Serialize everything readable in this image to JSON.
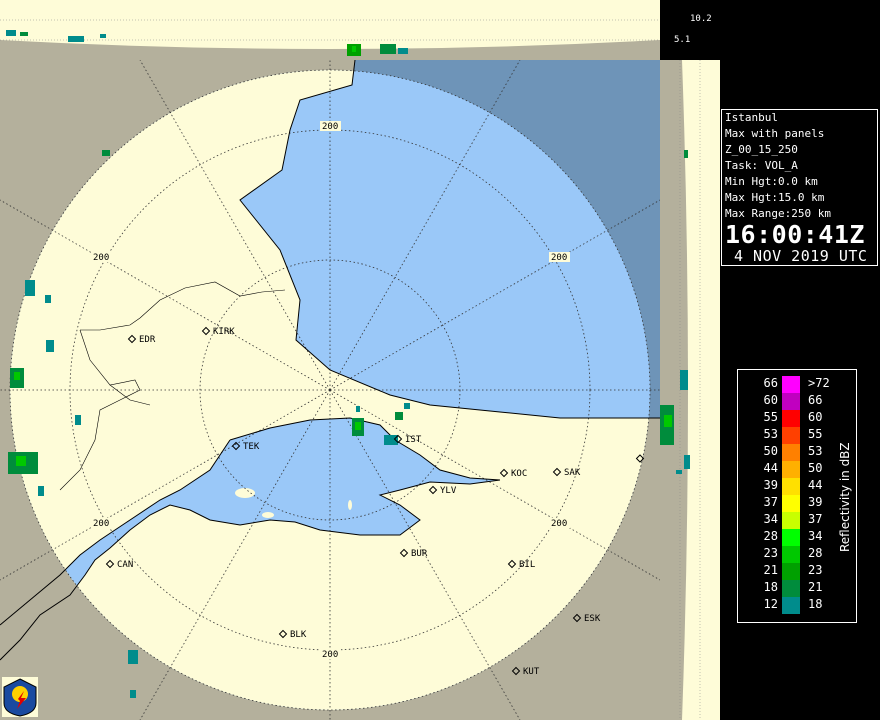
{
  "info": {
    "location": "Istanbul",
    "product": "Max with panels",
    "product_code": "Z_00_15_250",
    "task": "Task: VOL_A",
    "min_height": "Min Hgt:0.0 km",
    "max_height": "Max Hgt:15.0 km",
    "max_range": "Max Range:250 km",
    "time": "16:00:41Z",
    "date": "4 NOV 2019 UTC"
  },
  "height_scale": {
    "top": "10.2",
    "bottom": "5.1"
  },
  "range_ring_label": "200",
  "legend": {
    "title": "Reflectivity in dBZ",
    "entries": [
      {
        "lo": "66",
        "hi": ">72",
        "color": "#ff00ff"
      },
      {
        "lo": "60",
        "hi": "66",
        "color": "#c000c0"
      },
      {
        "lo": "55",
        "hi": "60",
        "color": "#ff0000"
      },
      {
        "lo": "53",
        "hi": "55",
        "color": "#ff4000"
      },
      {
        "lo": "50",
        "hi": "53",
        "color": "#ff8000"
      },
      {
        "lo": "44",
        "hi": "50",
        "color": "#ffb000"
      },
      {
        "lo": "39",
        "hi": "44",
        "color": "#ffe000"
      },
      {
        "lo": "37",
        "hi": "39",
        "color": "#ffff00"
      },
      {
        "lo": "34",
        "hi": "37",
        "color": "#c8ff00"
      },
      {
        "lo": "28",
        "hi": "34",
        "color": "#00ff00"
      },
      {
        "lo": "23",
        "hi": "28",
        "color": "#00c800"
      },
      {
        "lo": "21",
        "hi": "23",
        "color": "#00a000"
      },
      {
        "lo": "18",
        "hi": "21",
        "color": "#008c3c"
      },
      {
        "lo": "12",
        "hi": "18",
        "color": "#008c8c"
      }
    ]
  },
  "cities": [
    {
      "code": "EDR"
    },
    {
      "code": "KIRK"
    },
    {
      "code": "TEK"
    },
    {
      "code": "IST"
    },
    {
      "code": "KOC"
    },
    {
      "code": "SAK"
    },
    {
      "code": "YLV"
    },
    {
      "code": "BUR"
    },
    {
      "code": "BIL"
    },
    {
      "code": "CAN"
    },
    {
      "code": "ESK"
    },
    {
      "code": "BLK"
    },
    {
      "code": "KUT"
    }
  ],
  "colors": {
    "sea_in_range": "#9ac8f8",
    "sea_out_range": "#6e94b8",
    "land_in_range": "#fefcd8",
    "land_out_range": "#b4b09c"
  }
}
